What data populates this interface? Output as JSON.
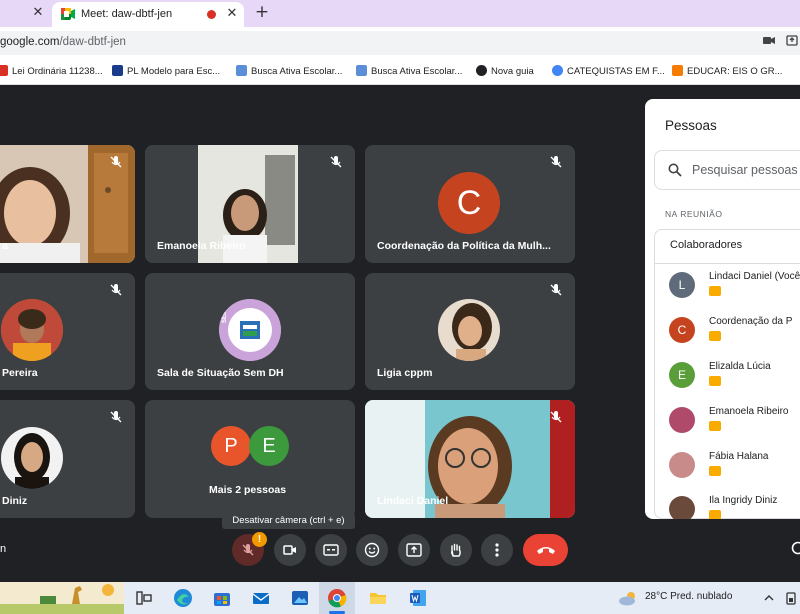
{
  "browser": {
    "tab_title": "Meet: daw-dbtf-jen",
    "close_glyph": "✕",
    "new_tab_glyph": "+",
    "url_host": "google.com",
    "url_path": "/daw-dbtf-jen"
  },
  "bookmarks": [
    {
      "label": "Lei Ordinária 11238...",
      "color": "#d93025"
    },
    {
      "label": "PL Modelo para Esc...",
      "color": "#1a3a8a"
    },
    {
      "label": "Busca Ativa Escolar...",
      "color": "#5b8ed6"
    },
    {
      "label": "Busca Ativa Escolar...",
      "color": "#5b8ed6"
    },
    {
      "label": "Nova guia",
      "color": "#202124"
    },
    {
      "label": "CATEQUISTAS EM F...",
      "color": "#4285f4"
    },
    {
      "label": "EDUCAR: EIS O GR...",
      "color": "#f57c00"
    }
  ],
  "tiles": [
    {
      "name": "a",
      "kind": "video"
    },
    {
      "name": "Emanoela Ribeiro",
      "kind": "video"
    },
    {
      "name": "Coordenação da Política da Mulh...",
      "kind": "letter",
      "letter": "C",
      "color": "#c5441f"
    },
    {
      "name": "Pereira",
      "kind": "photo"
    },
    {
      "name": "Sala de Situação Sem DH",
      "kind": "logo",
      "logo_text": "SEMDH"
    },
    {
      "name": "Ligia cppm",
      "kind": "photo"
    },
    {
      "name": "Diniz",
      "kind": "photo"
    },
    {
      "name": "Mais 2 pessoas",
      "kind": "more",
      "letters": [
        "P",
        "E"
      ]
    },
    {
      "name": "Lindaci Daniel",
      "kind": "video"
    }
  ],
  "panel": {
    "title": "Pessoas",
    "search_placeholder": "Pesquisar pessoas",
    "section": "NA REUNIÃO",
    "group": "Colaboradores",
    "people": [
      {
        "name": "Lindaci Daniel (Você)",
        "initial": "L",
        "color": "#5f6b7a"
      },
      {
        "name": "Coordenação da P",
        "initial": "C",
        "color": "#c5441f"
      },
      {
        "name": "Elizalda Lúcia",
        "initial": "E",
        "color": "#5a9e3a"
      },
      {
        "name": "Emanoela Ribeiro",
        "initial": "",
        "color": "#b04a6a"
      },
      {
        "name": "Fábia Halana",
        "initial": "",
        "color": "#c98a8a"
      },
      {
        "name": "Ila Ingridy Diniz",
        "initial": "",
        "color": "#6a4a3a"
      }
    ]
  },
  "controls": {
    "tooltip": "Desativar câmera (ctrl + e)",
    "alert_badge": "!",
    "meeting_code_fragment": "n"
  },
  "taskbar": {
    "weather": "28°C  Pred. nublado"
  }
}
